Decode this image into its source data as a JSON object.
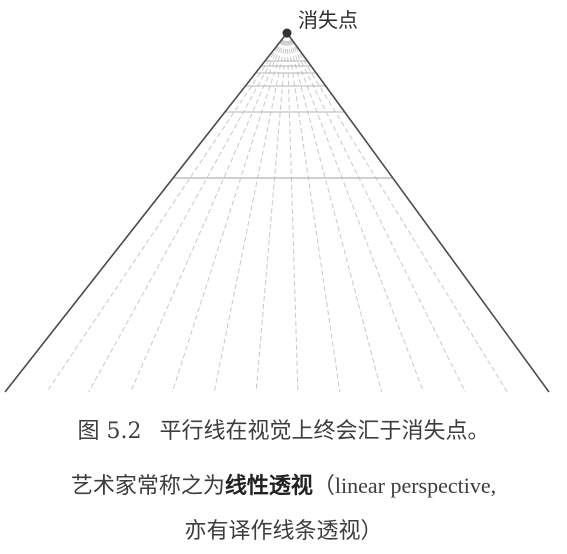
{
  "diagram": {
    "vanishing_point_label": "消失点",
    "colors": {
      "edge_line": "#4a4a4a",
      "ray_line": "#c9c9c9",
      "cross_line": "#b5b5b5",
      "point": "#333333"
    }
  },
  "caption": {
    "figure_number": "图 5.2",
    "line1": "平行线在视觉上终会汇于消失点。",
    "line2_prefix": "艺术家常称之为",
    "line2_term": "线性透视",
    "line2_paren_open": "（",
    "line2_latin": "linear perspective,",
    "line3": "亦有译作线条透视）"
  }
}
